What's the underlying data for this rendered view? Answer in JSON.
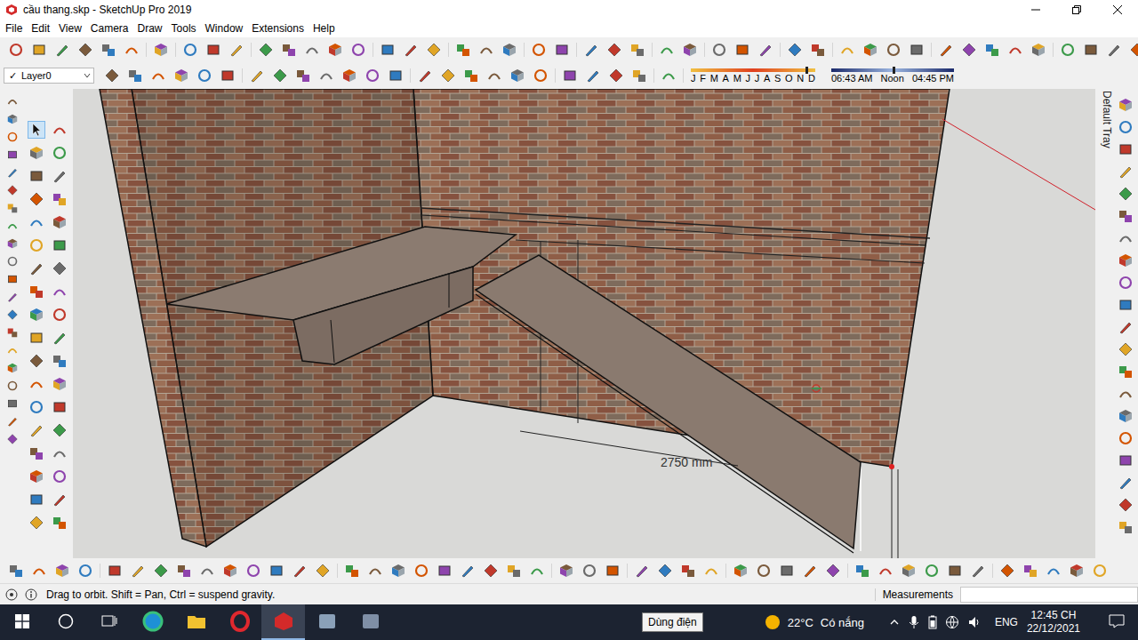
{
  "window": {
    "title": "cầu thang.skp - SketchUp Pro 2019"
  },
  "menu": [
    "File",
    "Edit",
    "View",
    "Camera",
    "Draw",
    "Tools",
    "Window",
    "Extensions",
    "Help"
  ],
  "layer": {
    "check": "✓",
    "name": "Layer0"
  },
  "shadows": {
    "months": [
      "J",
      "F",
      "M",
      "A",
      "M",
      "J",
      "J",
      "A",
      "S",
      "O",
      "N",
      "D"
    ],
    "date_level": 0.92,
    "times": [
      "06:43 AM",
      "Noon",
      "04:45 PM"
    ],
    "time_level": 0.5
  },
  "left_toolbar": [
    {
      "selected": true
    },
    {
      "selected": false
    },
    {
      "selected": false
    },
    {
      "selected": false
    },
    {
      "selected": false
    },
    {
      "selected": false
    },
    {
      "selected": false
    },
    {
      "selected": false
    },
    {
      "selected": false
    },
    {
      "selected": false
    },
    {
      "selected": false
    },
    {
      "selected": false
    },
    {
      "selected": false
    },
    {
      "selected": false
    },
    {
      "selected": false
    },
    {
      "selected": false
    },
    {
      "selected": false
    },
    {
      "selected": false
    },
    {
      "selected": false
    },
    {
      "selected": false
    },
    {
      "selected": false
    },
    {
      "selected": false
    },
    {
      "selected": false
    },
    {
      "selected": false
    },
    {
      "selected": false
    },
    {
      "selected": false
    },
    {
      "selected": false
    },
    {
      "selected": false
    },
    {
      "selected": false
    },
    {
      "selected": false
    },
    {
      "selected": false
    },
    {
      "selected": false
    },
    {
      "selected": false
    },
    {
      "selected": false
    },
    {
      "selected": false
    },
    {
      "selected": false
    }
  ],
  "viewport": {
    "dimension": "2750 mm"
  },
  "tray": {
    "title": "Default Tray"
  },
  "status_bar": {
    "hint": "Drag to orbit. Shift = Pan, Ctrl = suspend gravity.",
    "measurements_label": "Measurements"
  },
  "taskbar": {
    "apps": [
      {
        "active": false
      },
      {
        "active": false
      },
      {
        "active": false
      },
      {
        "active": true
      },
      {
        "active": false
      },
      {
        "active": false
      }
    ],
    "tooltip": "Dùng điện",
    "weather": {
      "temp": "22°C",
      "condition": "Có nắng"
    },
    "language": "ENG",
    "time": "12:45 CH",
    "date": "22/12/2021"
  }
}
